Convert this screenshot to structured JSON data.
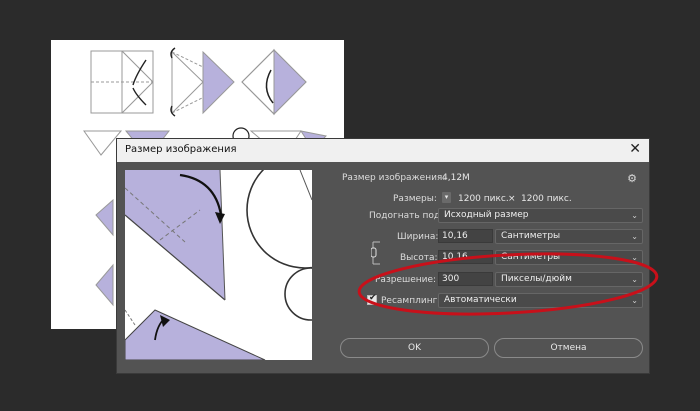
{
  "dialog": {
    "title": "Размер изображения",
    "close_symbol": "✕",
    "settings_icon": "gear-icon"
  },
  "info": {
    "image_size_label": "Размер изображения:",
    "image_size_value": "4,12M",
    "dimensions_label": "Размеры:",
    "dimensions_width": "1200 пикс.",
    "dimensions_times": "×",
    "dimensions_height": "1200 пикс."
  },
  "fit_to": {
    "label": "Подогнать под:",
    "value": "Исходный размер"
  },
  "width": {
    "label": "Ширина:",
    "value": "10,16",
    "unit": "Сантиметры"
  },
  "height": {
    "label": "Высота:",
    "value": "10,16",
    "unit": "Сантиметры"
  },
  "resolution": {
    "label": "Разрешение:",
    "value": "300",
    "unit": "Пикселы/дюйм"
  },
  "resample": {
    "label": "Ресамплинг:",
    "value": "Автоматически",
    "checked": true
  },
  "buttons": {
    "ok": "OK",
    "cancel": "Отмена"
  },
  "colors": {
    "accent_lavender": "#b7b1dc",
    "highlight_ellipse": "#c8101a",
    "dialog_bg": "#535353"
  }
}
